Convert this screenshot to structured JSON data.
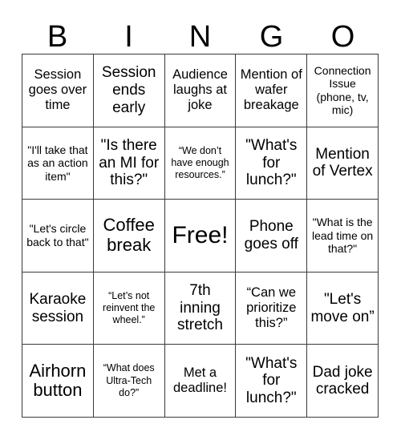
{
  "card": {
    "header_letters": [
      "B",
      "I",
      "N",
      "G",
      "O"
    ],
    "rows": [
      [
        {
          "text": "Session goes over time",
          "size": "md"
        },
        {
          "text": "Session ends early",
          "size": "lg"
        },
        {
          "text": "Audience laughs at joke",
          "size": "md"
        },
        {
          "text": "Mention of wafer breakage",
          "size": "md"
        },
        {
          "text": "Connection Issue (phone, tv, mic)",
          "size": "sm"
        }
      ],
      [
        {
          "text": "\"I'll take that as an action item\"",
          "size": "sm"
        },
        {
          "text": "\"Is there an MI for this?\"",
          "size": "lg"
        },
        {
          "text": "“We don’t have enough resources.”",
          "size": "xs"
        },
        {
          "text": "\"What's for lunch?\"",
          "size": "lg"
        },
        {
          "text": "Mention of Vertex",
          "size": "lg"
        }
      ],
      [
        {
          "text": "\"Let's circle back to that\"",
          "size": "sm"
        },
        {
          "text": "Coffee break",
          "size": "xl"
        },
        {
          "text": "Free!",
          "size": "xxl"
        },
        {
          "text": "Phone goes off",
          "size": "lg"
        },
        {
          "text": "\"What is the lead time on that?\"",
          "size": "sm"
        }
      ],
      [
        {
          "text": "Karaoke session",
          "size": "lg"
        },
        {
          "text": "“Let’s not reinvent the wheel.”",
          "size": "xs"
        },
        {
          "text": "7th inning stretch",
          "size": "lg"
        },
        {
          "text": "“Can we prioritize this?”",
          "size": "md"
        },
        {
          "text": "\"Let's move on”",
          "size": "lg"
        }
      ],
      [
        {
          "text": "Airhorn button",
          "size": "xl"
        },
        {
          "text": "“What does Ultra-Tech do?”",
          "size": "xs"
        },
        {
          "text": "Met a deadline!",
          "size": "md"
        },
        {
          "text": "\"What's for lunch?\"",
          "size": "lg"
        },
        {
          "text": "Dad joke cracked",
          "size": "lg"
        }
      ]
    ]
  },
  "colors": {
    "background": "#ffffff",
    "text": "#000000",
    "grid_line": "#3a3a3a"
  }
}
